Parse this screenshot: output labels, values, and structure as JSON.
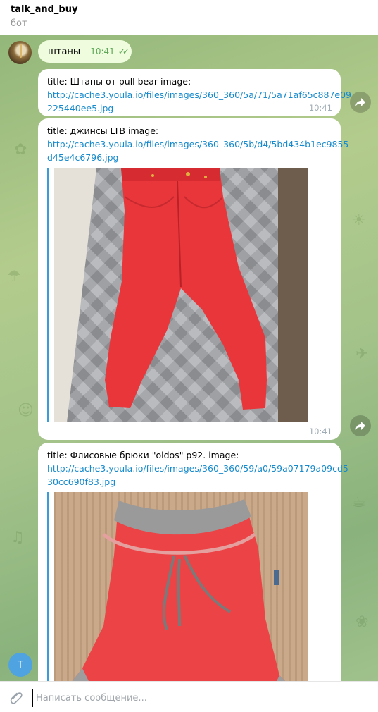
{
  "header": {
    "title": "talk_and_buy",
    "status": "бот"
  },
  "messages": {
    "outgoing": {
      "text": "штаны",
      "time": "10:41",
      "read_status": "read-double-check"
    },
    "incoming": [
      {
        "line1": "title: Штаны от pull bear image:",
        "link1": "http://cache3.youla.io/files/images/360_360/5a/71/5a71af65c887e09",
        "link2": "225440ee5.jpg",
        "time": "10:41"
      },
      {
        "line1": "title: джинсы LTB image:",
        "link1": "http://cache3.youla.io/files/images/360_360/5b/d4/5bd434b1ec9855",
        "link2": "d45e4c6796.jpg",
        "time": "10:41"
      },
      {
        "line1": "title: Флисовые брюки \"oldos\" р92. image:",
        "link1": "http://cache3.youla.io/files/images/360_360/59/a0/59a07179a09cd5",
        "link2": "30cc690f83.jpg"
      }
    ]
  },
  "scroll_avatar_letter": "T",
  "composer": {
    "placeholder": "Написать сообщение..."
  },
  "colors": {
    "link": "#168acd",
    "accent_blue": "#4fa3e0",
    "outgoing_bubble": "#effdde",
    "pants_red": "#e8363a"
  }
}
